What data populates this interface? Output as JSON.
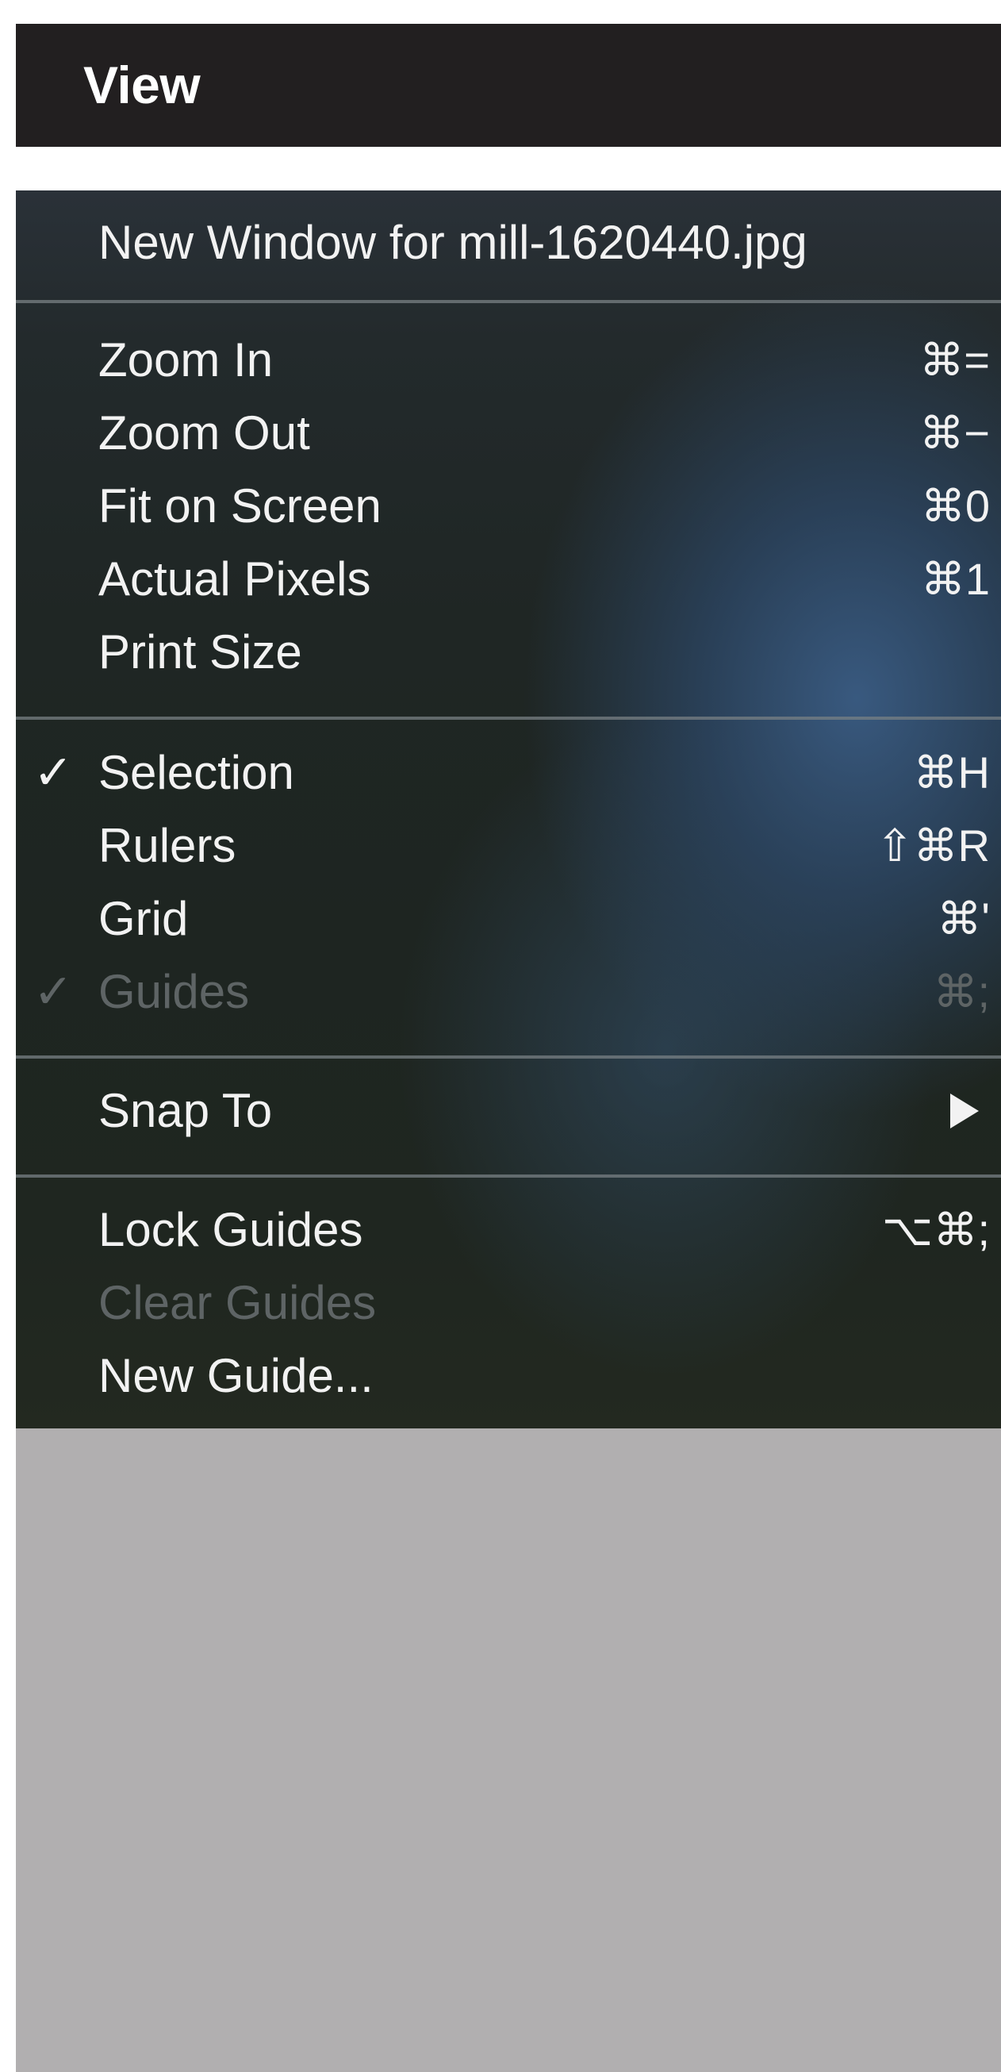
{
  "menubar": {
    "title": "View"
  },
  "menu": {
    "items": [
      {
        "label": "New Window for mill-1620440.jpg",
        "shortcut": "",
        "checked": false,
        "enabled": true
      },
      {
        "label": "Zoom In",
        "shortcut": "⌘=",
        "checked": false,
        "enabled": true
      },
      {
        "label": "Zoom Out",
        "shortcut": "⌘−",
        "checked": false,
        "enabled": true
      },
      {
        "label": "Fit on Screen",
        "shortcut": "⌘0",
        "checked": false,
        "enabled": true
      },
      {
        "label": "Actual Pixels",
        "shortcut": "⌘1",
        "checked": false,
        "enabled": true
      },
      {
        "label": "Print Size",
        "shortcut": "",
        "checked": false,
        "enabled": true
      },
      {
        "label": "Selection",
        "shortcut": "⌘H",
        "checked": true,
        "enabled": true
      },
      {
        "label": "Rulers",
        "shortcut": "⇧⌘R",
        "checked": false,
        "enabled": true
      },
      {
        "label": "Grid",
        "shortcut": "⌘'",
        "checked": false,
        "enabled": true
      },
      {
        "label": "Guides",
        "shortcut": "⌘;",
        "checked": true,
        "enabled": false
      },
      {
        "label": "Snap To",
        "shortcut": "",
        "checked": false,
        "enabled": true,
        "submenu": true
      },
      {
        "label": "Lock Guides",
        "shortcut": "⌥⌘;",
        "checked": false,
        "enabled": true
      },
      {
        "label": "Clear Guides",
        "shortcut": "",
        "checked": false,
        "enabled": false
      },
      {
        "label": "New Guide...",
        "shortcut": "",
        "checked": false,
        "enabled": true
      }
    ],
    "check_glyph": "✓",
    "submenu_icon": "triangle-right-icon"
  }
}
